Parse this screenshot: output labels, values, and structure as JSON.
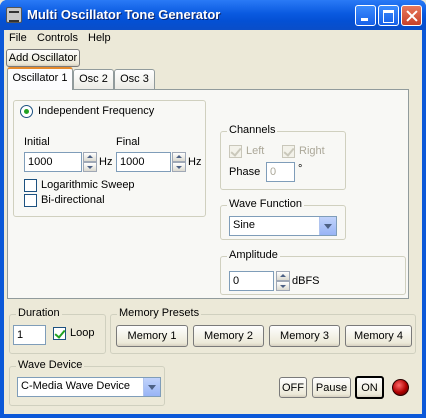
{
  "window": {
    "title": "Multi Oscillator Tone Generator"
  },
  "menu": [
    "File",
    "Controls",
    "Help"
  ],
  "toolbar": {
    "add_oscillator": "Add Oscillator"
  },
  "tabs": [
    "Oscillator 1",
    "Osc 2",
    "Osc 3"
  ],
  "frequency": {
    "independent_label": "Independent Frequency",
    "independent_selected": true,
    "initial_label": "Initial",
    "initial_value": "1000",
    "final_label": "Final",
    "final_value": "1000",
    "unit": "Hz",
    "log_sweep_label": "Logarithmic Sweep",
    "log_sweep_checked": false,
    "bidirectional_label": "Bi-directional",
    "bidirectional_checked": false
  },
  "channels": {
    "title": "Channels",
    "left_label": "Left",
    "left_checked": true,
    "right_label": "Right",
    "right_checked": true,
    "phase_label": "Phase",
    "phase_value": "0",
    "phase_unit": "°"
  },
  "wave_function": {
    "title": "Wave Function",
    "selected": "Sine"
  },
  "amplitude": {
    "title": "Amplitude",
    "value": "0",
    "unit": "dBFS"
  },
  "duration": {
    "title": "Duration",
    "value": "1",
    "loop_label": "Loop",
    "loop_checked": true
  },
  "memory_presets": {
    "title": "Memory Presets",
    "buttons": [
      "Memory 1",
      "Memory 2",
      "Memory 3",
      "Memory 4"
    ]
  },
  "wave_device": {
    "title": "Wave Device",
    "selected": "C-Media Wave Device"
  },
  "controls": {
    "off": "OFF",
    "pause": "Pause",
    "on": "ON"
  },
  "colors": {
    "titlebar": "#0a5ae0",
    "led": "#c00000",
    "active_tab_accent": "#e68b2c"
  }
}
